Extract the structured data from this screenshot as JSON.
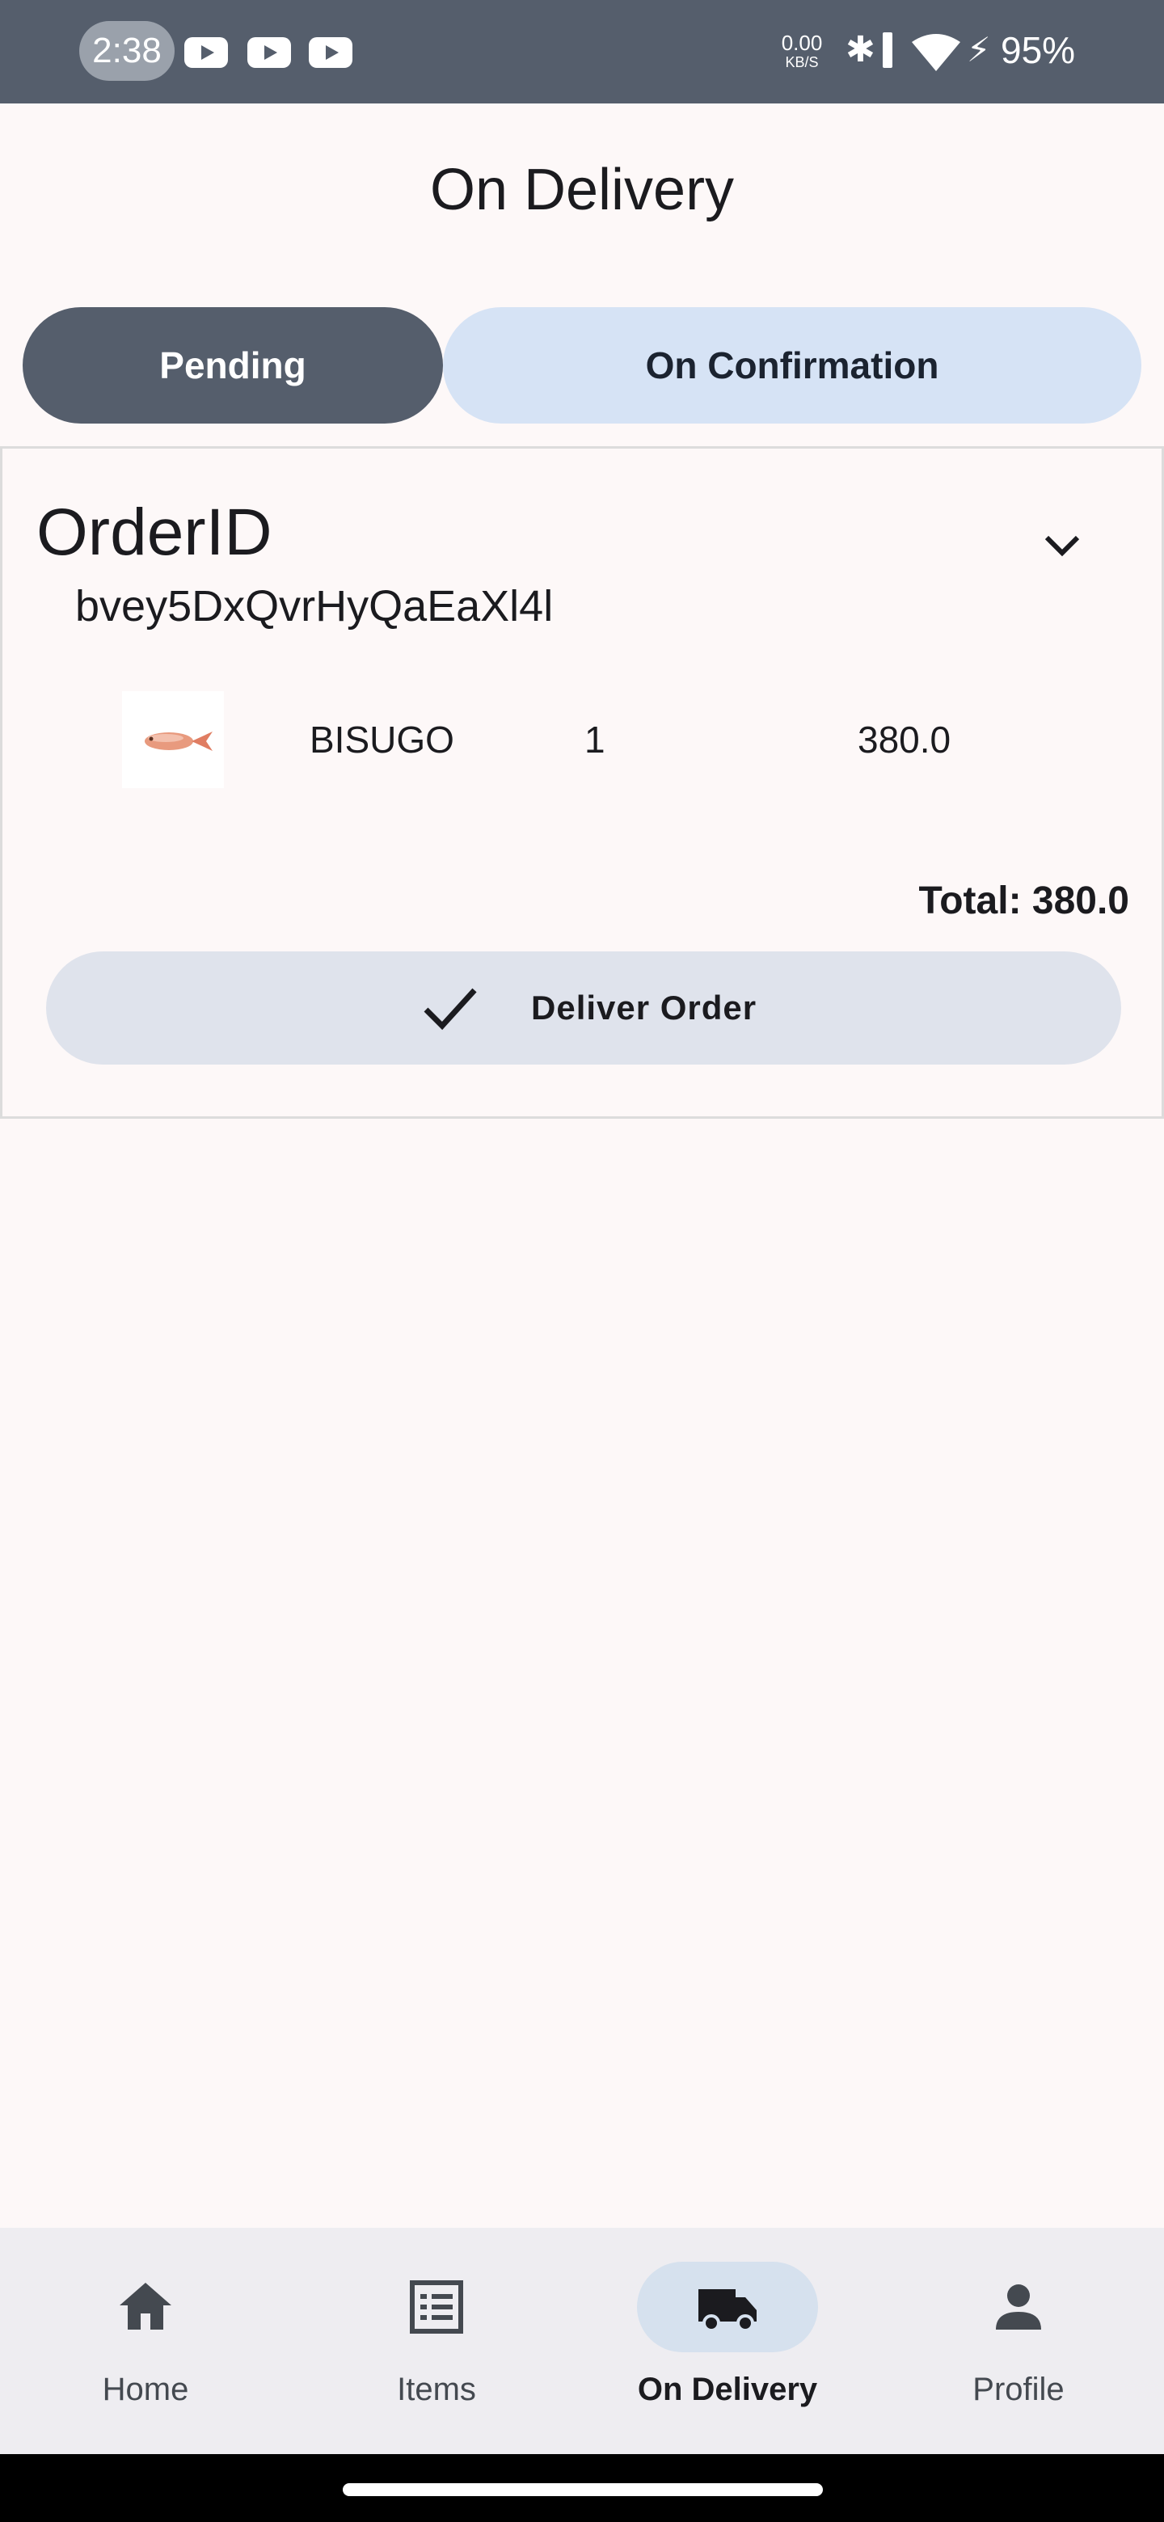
{
  "status_bar": {
    "time": "2:38",
    "notification_icons": [
      "youtube-icon",
      "youtube-icon",
      "youtube-icon"
    ],
    "net_speed_value": "0.00",
    "net_speed_unit": "KB/S",
    "battery": "95%",
    "colors": {
      "background": "#555e6c"
    }
  },
  "header": {
    "title": "On Delivery"
  },
  "tabs": [
    {
      "label": "Pending",
      "selected": true
    },
    {
      "label": "On Confirmation",
      "selected": false
    }
  ],
  "order": {
    "label": "OrderID",
    "id": "bvey5DxQvrHyQaEaXl4l",
    "items": [
      {
        "image": "fish-icon",
        "name": "BISUGO",
        "qty": "1",
        "price": "380.0"
      }
    ],
    "total": "Total: 380.0",
    "deliver_button": "Deliver Order"
  },
  "bottom_nav": [
    {
      "label": "Home",
      "icon": "home-icon",
      "active": false
    },
    {
      "label": "Items",
      "icon": "list-icon",
      "active": false
    },
    {
      "label": "On Delivery",
      "icon": "truck-icon",
      "active": true
    },
    {
      "label": "Profile",
      "icon": "person-icon",
      "active": false
    }
  ],
  "colors": {
    "primary": "#555e6c",
    "secondary_container": "#d6e3f5",
    "background": "#fdf8f8"
  }
}
